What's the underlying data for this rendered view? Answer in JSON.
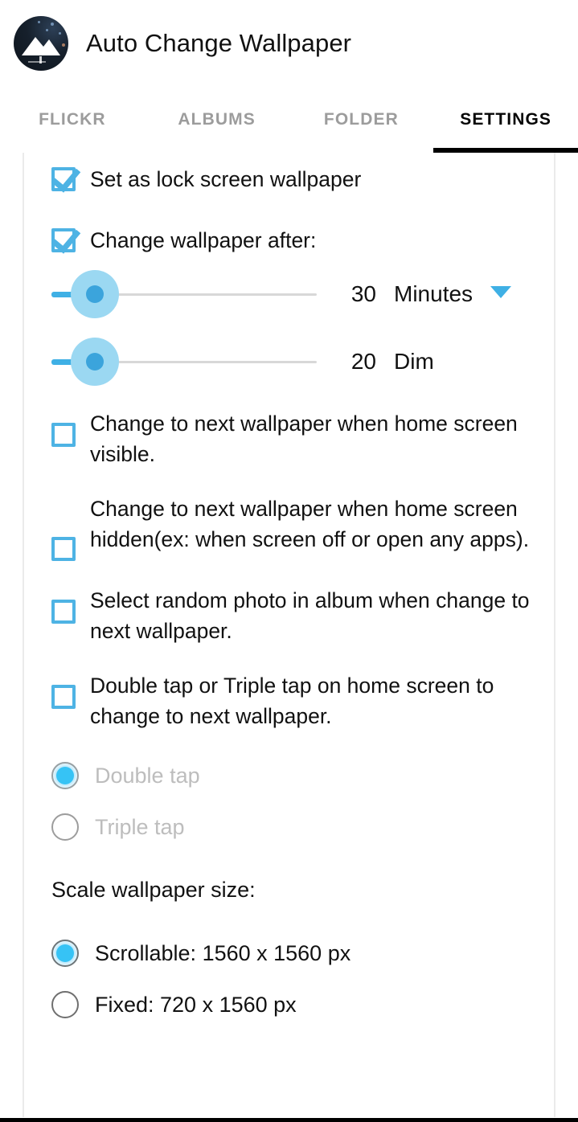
{
  "app": {
    "title": "Auto Change Wallpaper",
    "icon": "mountain-logo-icon"
  },
  "tabs": [
    {
      "label": "FLICKR",
      "active": false
    },
    {
      "label": "ALBUMS",
      "active": false
    },
    {
      "label": "FOLDER",
      "active": false
    },
    {
      "label": "SETTINGS",
      "active": true
    }
  ],
  "settings": {
    "lock_screen": {
      "label": "Set as lock screen wallpaper",
      "checked": true
    },
    "change_after": {
      "label": "Change wallpaper after:",
      "checked": true
    },
    "interval_slider": {
      "value": "30",
      "unit": "Minutes",
      "dropdown_icon": "chevron-down-icon"
    },
    "dim_slider": {
      "value": "20",
      "unit": "Dim"
    },
    "checkboxes": [
      {
        "label": "Change to next wallpaper when home screen visible.",
        "checked": false
      },
      {
        "label": "Change to next wallpaper when home screen hidden(ex: when screen off or open any apps).",
        "checked": false
      },
      {
        "label": "Select random photo in album when change to next wallpaper.",
        "checked": false
      },
      {
        "label": "Double tap or Triple tap on home screen to change to next wallpaper.",
        "checked": false
      }
    ],
    "tap_mode": {
      "options": [
        {
          "label": "Double tap",
          "selected": true,
          "disabled": true
        },
        {
          "label": "Triple tap",
          "selected": false,
          "disabled": true
        }
      ]
    },
    "scale": {
      "title": "Scale wallpaper size:",
      "options": [
        {
          "label": "Scrollable: 1560 x 1560 px",
          "selected": true
        },
        {
          "label": "Fixed: 720 x 1560 px",
          "selected": false
        }
      ]
    }
  },
  "colors": {
    "accent_blue": "#4eb3e4",
    "slider_halo": "#9bd8f2",
    "radio_fill": "#36c3f5",
    "tab_inactive": "#9c9c9c",
    "tab_active": "#050505",
    "indicator": "#000000"
  }
}
